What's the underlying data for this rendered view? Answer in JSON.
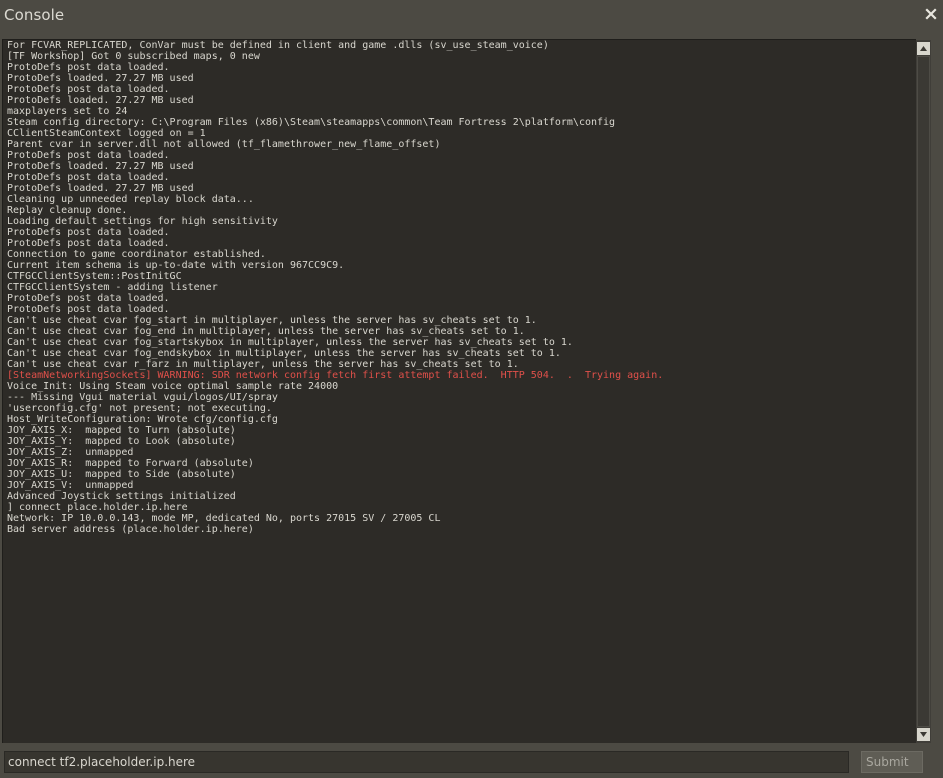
{
  "window": {
    "title": "Console"
  },
  "colors": {
    "background": "#4c4a43",
    "console_bg": "#2d2b27",
    "text": "#d9d7cf",
    "warning": "#e0504a"
  },
  "icons": {
    "close": "close-icon",
    "scroll_up": "arrow-up-icon",
    "scroll_down": "arrow-down-icon"
  },
  "console": {
    "lines": [
      {
        "text": "For FCVAR_REPLICATED, ConVar must be defined in client and game .dlls (sv_use_steam_voice)",
        "level": "normal"
      },
      {
        "text": "[TF Workshop] Got 0 subscribed maps, 0 new",
        "level": "normal"
      },
      {
        "text": "ProtoDefs post data loaded.",
        "level": "normal"
      },
      {
        "text": "ProtoDefs loaded. 27.27 MB used",
        "level": "normal"
      },
      {
        "text": "ProtoDefs post data loaded.",
        "level": "normal"
      },
      {
        "text": "ProtoDefs loaded. 27.27 MB used",
        "level": "normal"
      },
      {
        "text": "maxplayers set to 24",
        "level": "normal"
      },
      {
        "text": "Steam config directory: C:\\Program Files (x86)\\Steam\\steamapps\\common\\Team Fortress 2\\platform\\config",
        "level": "normal"
      },
      {
        "text": "CClientSteamContext logged on = 1",
        "level": "normal"
      },
      {
        "text": "Parent cvar in server.dll not allowed (tf_flamethrower_new_flame_offset)",
        "level": "normal"
      },
      {
        "text": "ProtoDefs post data loaded.",
        "level": "normal"
      },
      {
        "text": "ProtoDefs loaded. 27.27 MB used",
        "level": "normal"
      },
      {
        "text": "ProtoDefs post data loaded.",
        "level": "normal"
      },
      {
        "text": "ProtoDefs loaded. 27.27 MB used",
        "level": "normal"
      },
      {
        "text": "Cleaning up unneeded replay block data...",
        "level": "normal"
      },
      {
        "text": "Replay cleanup done.",
        "level": "normal"
      },
      {
        "text": "Loading default settings for high sensitivity",
        "level": "normal"
      },
      {
        "text": "ProtoDefs post data loaded.",
        "level": "normal"
      },
      {
        "text": "ProtoDefs post data loaded.",
        "level": "normal"
      },
      {
        "text": "Connection to game coordinator established.",
        "level": "normal"
      },
      {
        "text": "Current item schema is up-to-date with version 967CC9C9.",
        "level": "normal"
      },
      {
        "text": "CTFGCClientSystem::PostInitGC",
        "level": "normal"
      },
      {
        "text": "CTFGCClientSystem - adding listener",
        "level": "normal"
      },
      {
        "text": "ProtoDefs post data loaded.",
        "level": "normal"
      },
      {
        "text": "ProtoDefs post data loaded.",
        "level": "normal"
      },
      {
        "text": "Can't use cheat cvar fog_start in multiplayer, unless the server has sv_cheats set to 1.",
        "level": "normal"
      },
      {
        "text": "Can't use cheat cvar fog_end in multiplayer, unless the server has sv_cheats set to 1.",
        "level": "normal"
      },
      {
        "text": "Can't use cheat cvar fog_startskybox in multiplayer, unless the server has sv_cheats set to 1.",
        "level": "normal"
      },
      {
        "text": "Can't use cheat cvar fog_endskybox in multiplayer, unless the server has sv_cheats set to 1.",
        "level": "normal"
      },
      {
        "text": "Can't use cheat cvar r_farz in multiplayer, unless the server has sv_cheats set to 1.",
        "level": "normal"
      },
      {
        "text": "[SteamNetworkingSockets] WARNING: SDR network config fetch first attempt failed.  HTTP 504.  .  Trying again.",
        "level": "warning"
      },
      {
        "text": "Voice_Init: Using Steam voice optimal sample rate 24000",
        "level": "normal"
      },
      {
        "text": "--- Missing Vgui material vgui/logos/UI/spray",
        "level": "normal"
      },
      {
        "text": "'userconfig.cfg' not present; not executing.",
        "level": "normal"
      },
      {
        "text": "Host_WriteConfiguration: Wrote cfg/config.cfg",
        "level": "normal"
      },
      {
        "text": "JOY_AXIS_X:  mapped to Turn (absolute)",
        "level": "normal"
      },
      {
        "text": "JOY_AXIS_Y:  mapped to Look (absolute)",
        "level": "normal"
      },
      {
        "text": "JOY_AXIS_Z:  unmapped",
        "level": "normal"
      },
      {
        "text": "JOY_AXIS_R:  mapped to Forward (absolute)",
        "level": "normal"
      },
      {
        "text": "JOY_AXIS_U:  mapped to Side (absolute)",
        "level": "normal"
      },
      {
        "text": "JOY_AXIS_V:  unmapped",
        "level": "normal"
      },
      {
        "text": "Advanced Joystick settings initialized",
        "level": "normal"
      },
      {
        "text": "] connect place.holder.ip.here",
        "level": "normal"
      },
      {
        "text": "Network: IP 10.0.0.143, mode MP, dedicated No, ports 27015 SV / 27005 CL",
        "level": "normal"
      },
      {
        "text": "Bad server address (place.holder.ip.here)",
        "level": "normal"
      }
    ]
  },
  "input": {
    "value": "connect tf2.placeholder.ip.here",
    "placeholder": ""
  },
  "submit": {
    "label": "Submit"
  }
}
